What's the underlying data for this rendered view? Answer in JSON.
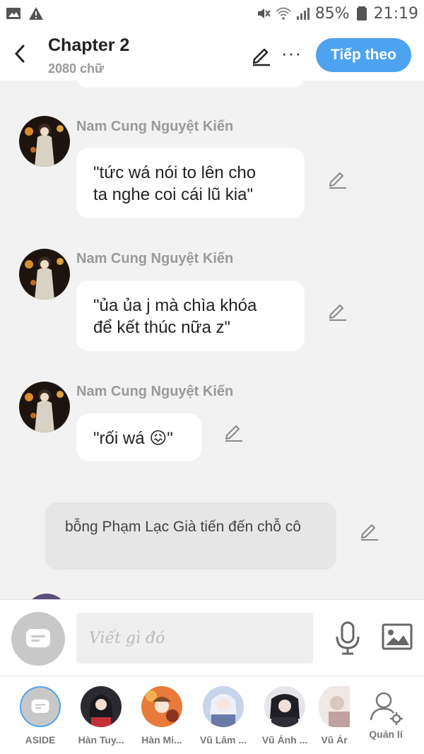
{
  "status_bar": {
    "battery": "85%",
    "time": "21:19"
  },
  "header": {
    "title": "Chapter 2",
    "word_count": "2080 chữ",
    "next_label": "Tiếp theo",
    "more_glyph": "···"
  },
  "chat": {
    "messages": [
      {
        "speaker": "Nam Cung Nguyệt Kiến",
        "line1": "\"tức wá nói to lên cho",
        "line2": "ta nghe coi cái lũ kia\""
      },
      {
        "speaker": "Nam Cung Nguyệt Kiến",
        "line1": "\"ủa ủa j mà chìa khóa",
        "line2": "để kết thúc nữa z\""
      },
      {
        "speaker": "Nam Cung Nguyệt Kiến",
        "line1": "\"rối wá 😖\"",
        "line2": ""
      }
    ],
    "narration": "bỗng Phạm Lạc Già tiến đến chỗ cô"
  },
  "composer": {
    "placeholder": "Viết gì đó"
  },
  "characters": [
    {
      "label": "ASIDE"
    },
    {
      "label": "Hàn Tuy..."
    },
    {
      "label": "Hàn Mi..."
    },
    {
      "label": "Vũ Lâm ..."
    },
    {
      "label": "Vũ Ánh ..."
    },
    {
      "label": "Vũ Ár"
    },
    {
      "label": "Quản lí"
    }
  ],
  "colors": {
    "accent": "#4ea3f0",
    "background": "#f2f2f2",
    "bubble": "#ffffff",
    "narration": "#e6e6e6"
  }
}
